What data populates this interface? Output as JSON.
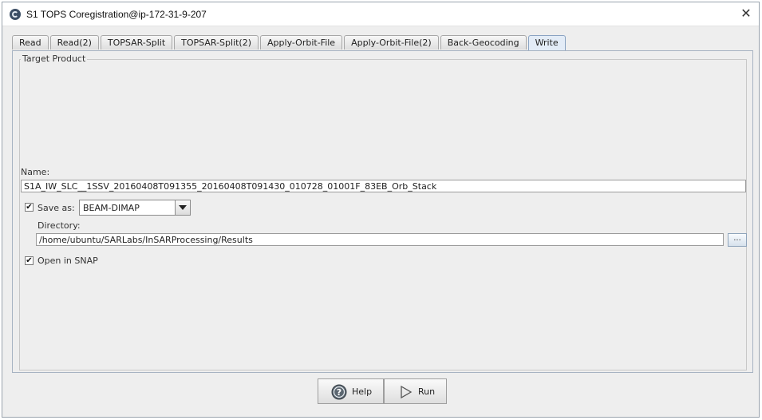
{
  "window": {
    "title": "S1 TOPS Coregistration@ip-172-31-9-207",
    "icon": "snap-app-icon",
    "close_glyph": "✕"
  },
  "tabs": [
    {
      "label": "Read",
      "active": false
    },
    {
      "label": "Read(2)",
      "active": false
    },
    {
      "label": "TOPSAR-Split",
      "active": false
    },
    {
      "label": "TOPSAR-Split(2)",
      "active": false
    },
    {
      "label": "Apply-Orbit-File",
      "active": false
    },
    {
      "label": "Apply-Orbit-File(2)",
      "active": false
    },
    {
      "label": "Back-Geocoding",
      "active": false
    },
    {
      "label": "Write",
      "active": true
    }
  ],
  "target_product": {
    "group_title": "Target Product",
    "name_label": "Name:",
    "name_value": "S1A_IW_SLC__1SSV_20160408T091355_20160408T091430_010728_01001F_83EB_Orb_Stack",
    "save_as": {
      "checked": true,
      "label": "Save as:",
      "format": "BEAM-DIMAP"
    },
    "directory_label": "Directory:",
    "directory_value": "/home/ubuntu/SARLabs/InSARProcessing/Results",
    "browse_label": "...",
    "open_in_snap": {
      "checked": true,
      "label": "Open in SNAP"
    }
  },
  "buttons": {
    "help_label": "Help",
    "run_label": "Run"
  },
  "colors": {
    "active_tab": "#e3ecf7",
    "help_icon": "#5b6670"
  }
}
